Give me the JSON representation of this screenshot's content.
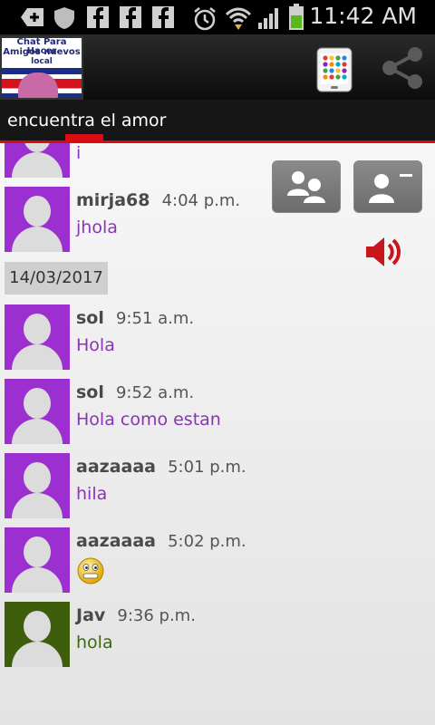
{
  "status_bar": {
    "time": "11:42 AM",
    "icons": [
      "add-icon",
      "shield-icon",
      "facebook-icon",
      "facebook-icon",
      "facebook-icon",
      "alarm-icon",
      "wifi-icon",
      "signal-icon",
      "battery-icon"
    ]
  },
  "action_bar": {
    "logo_line1": "Chat Para Hacer",
    "logo_line2": "Amigos nuevos",
    "logo_line3": "local",
    "actions": [
      "phone-apps-icon",
      "share-icon"
    ]
  },
  "tab": {
    "label": "encuentra el amor"
  },
  "messages": [
    {
      "user": "",
      "time": "",
      "text": "i",
      "avatar": "purple"
    },
    {
      "user": "mirja68",
      "time": "4:04 p.m.",
      "text": "jhola",
      "avatar": "purple"
    },
    {
      "user": "sol",
      "time": "9:51 a.m.",
      "text": "Hola",
      "avatar": "purple"
    },
    {
      "user": "sol",
      "time": "9:52 a.m.",
      "text": "Hola como estan",
      "avatar": "purple"
    },
    {
      "user": "aazaaaa",
      "time": "5:01 p.m.",
      "text": "hila",
      "avatar": "purple"
    },
    {
      "user": "aazaaaa",
      "time": "5:02 p.m.",
      "text": "",
      "emoji": "smiley",
      "avatar": "purple"
    },
    {
      "user": "Jav",
      "time": "9:36 p.m.",
      "text": "hola",
      "avatar": "green"
    }
  ],
  "date_separator": "14/03/2017",
  "side_buttons": [
    "users-group-icon",
    "remove-user-icon"
  ],
  "colors": {
    "accent": "#d60e12",
    "avatar_purple": "#9b2fcf",
    "avatar_green": "#3e5e0c",
    "text_purple": "#8b34b5",
    "text_green": "#3d6a0d"
  }
}
